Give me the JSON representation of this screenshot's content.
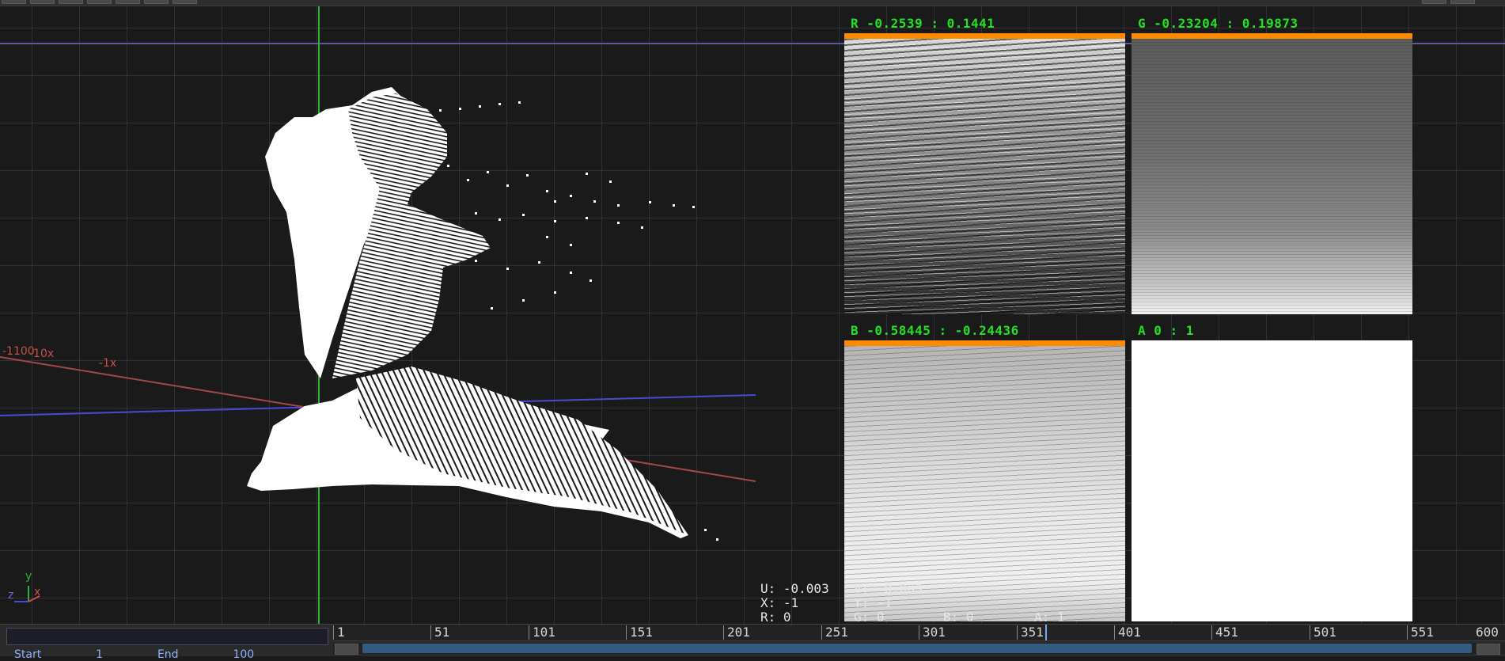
{
  "viewer": {
    "tiles": [
      {
        "label": "R -0.2539 : 0.1441"
      },
      {
        "label": "G -0.23204 : 0.19873"
      },
      {
        "label": "B -0.58445 : -0.24436"
      },
      {
        "label": "A 0 : 1"
      }
    ],
    "axis_labels": [
      "-1100",
      "-10x",
      "-1x",
      "z",
      "y",
      "x"
    ],
    "readout": {
      "u": "U: -0.003",
      "v": "V: -0.003",
      "x": "X: -1",
      "y": "Y: -1",
      "r": "R: 0",
      "g": "G: 0",
      "b": "B: 0",
      "a": "A: 1"
    }
  },
  "timeline": {
    "ticks": [
      "1",
      "51",
      "101",
      "151",
      "201",
      "251",
      "301",
      "351",
      "401",
      "451",
      "501",
      "551",
      "600"
    ],
    "start_label": "Start",
    "start_value": "1",
    "end_label": "End",
    "end_value": "100"
  },
  "colors": {
    "tile_label": "#22e022",
    "range_bar": "#ff8a00",
    "axis_x": "#c8504a",
    "axis_z": "#4a4ad0",
    "axis_y": "#30b030",
    "playhead": "#7aa6ff"
  }
}
